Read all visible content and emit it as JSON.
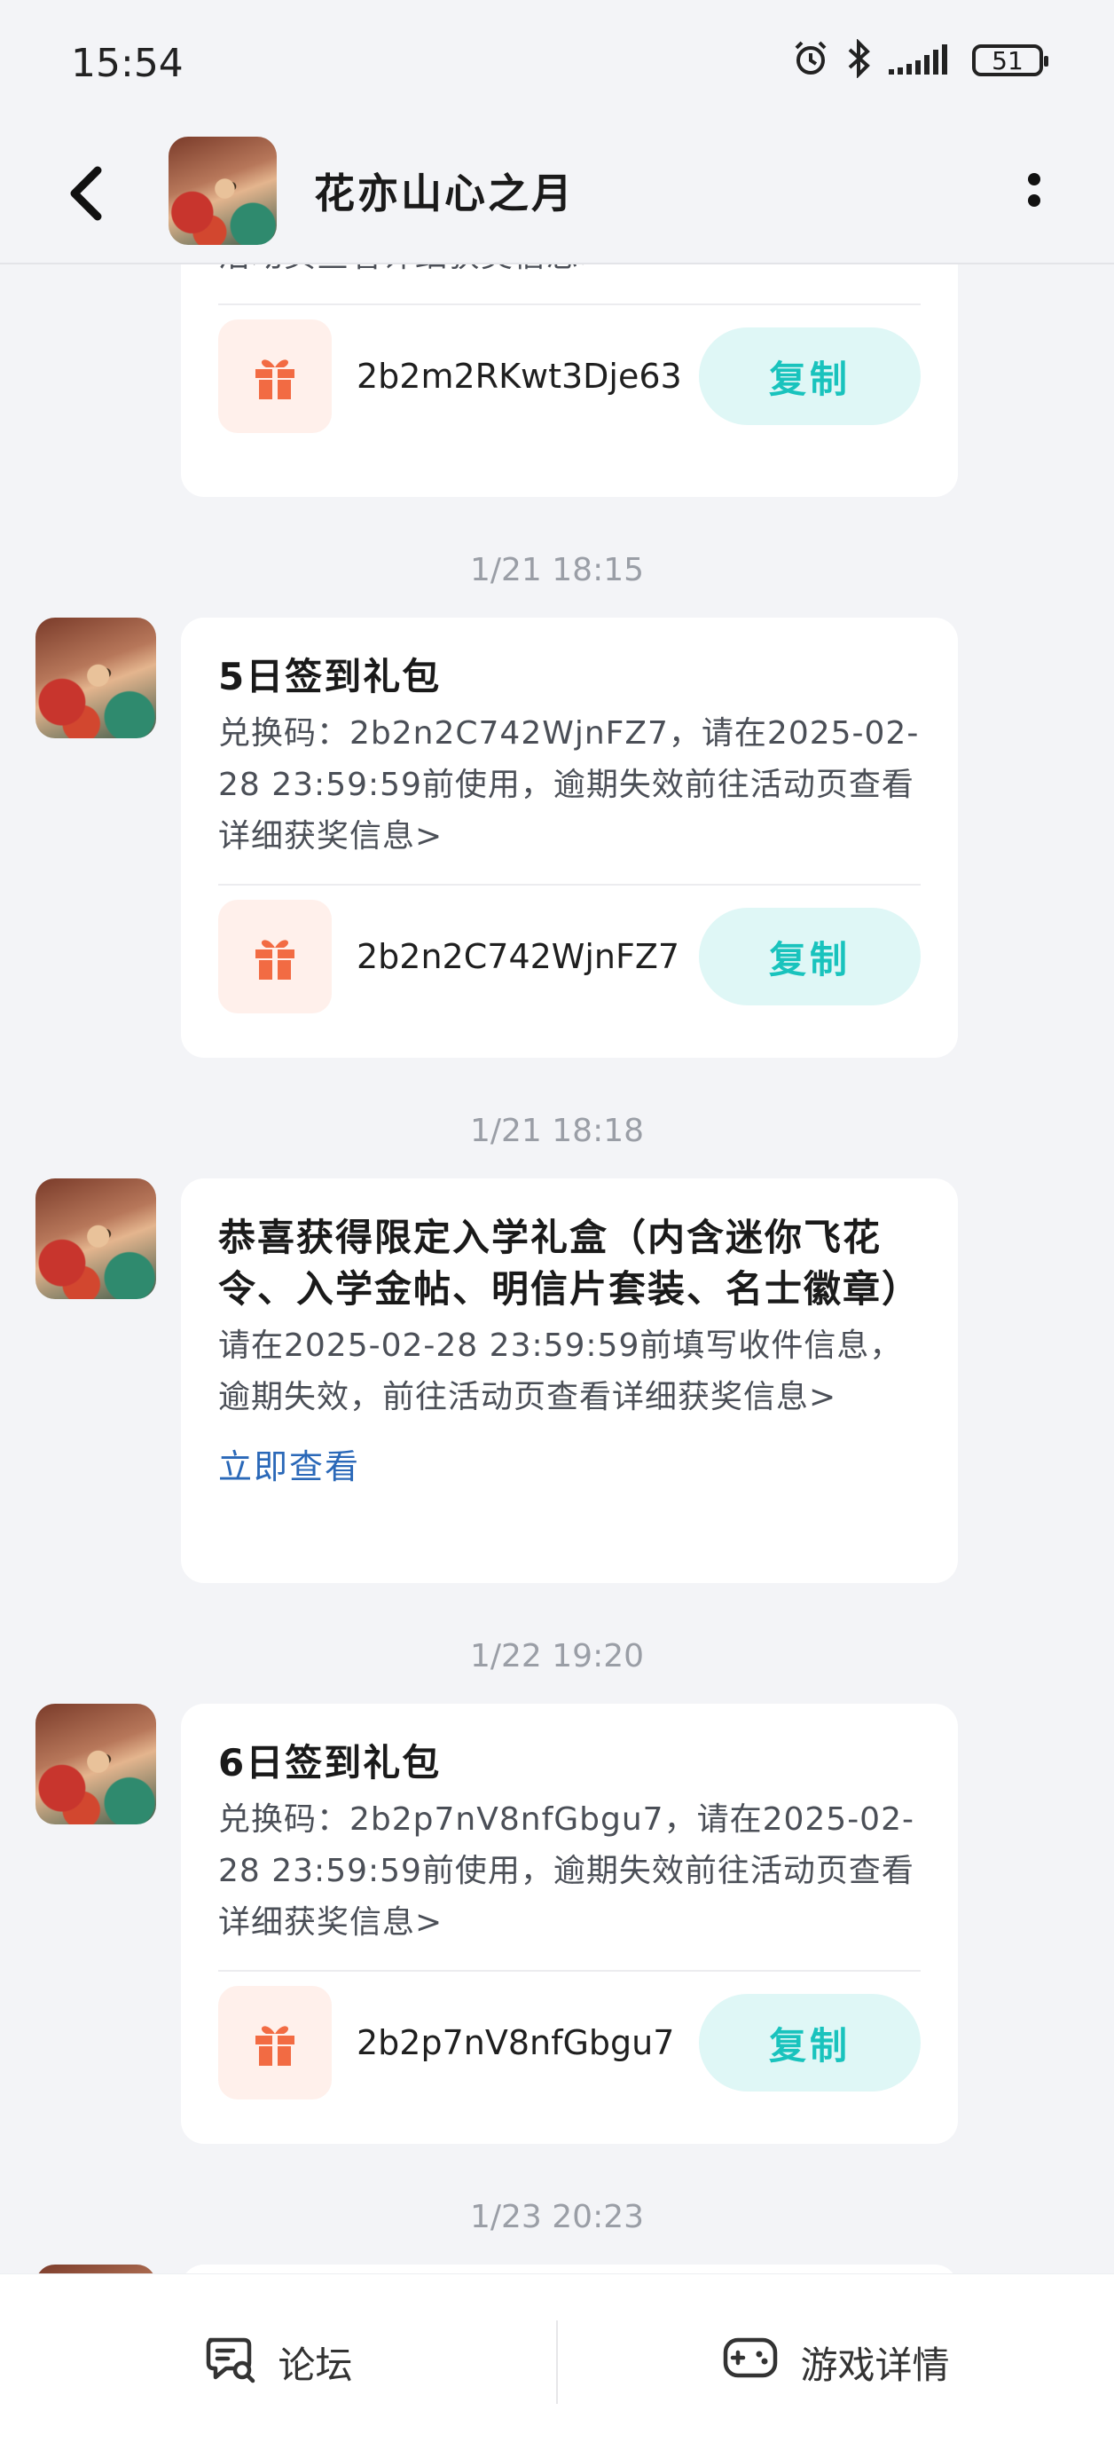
{
  "status_bar": {
    "time": "15:54",
    "battery": "51"
  },
  "header": {
    "title": "花亦山心之月"
  },
  "messages": [
    {
      "body": "活动页查看详细获奖信息>",
      "code": "2b2m2RKwt3Dje63",
      "copy_label": "复制"
    },
    {
      "timestamp": "1/21  18:15",
      "title": "5日签到礼包",
      "body": "兑换码：2b2n2C742WjnFZ7，请在2025-02-28 23:59:59前使用，逾期失效前往活动页查看详细获奖信息>",
      "code": "2b2n2C742WjnFZ7",
      "copy_label": "复制"
    },
    {
      "timestamp": "1/21  18:18",
      "title": "恭喜获得限定入学礼盒（内含迷你飞花令、入学金帖、明信片套装、名士徽章）",
      "body": "请在2025-02-28 23:59:59前填写收件信息，逾期失效，前往活动页查看详细获奖信息>",
      "link": "立即查看"
    },
    {
      "timestamp": "1/22  19:20",
      "title": "6日签到礼包",
      "body": "兑换码：2b2p7nV8nfGbgu7，请在2025-02-28 23:59:59前使用，逾期失效前往活动页查看详细获奖信息>",
      "code": "2b2p7nV8nfGbgu7",
      "copy_label": "复制"
    },
    {
      "timestamp": "1/23  20:23"
    }
  ],
  "bottom_nav": {
    "forum_label": "论坛",
    "game_detail_label": "游戏详情"
  },
  "colors": {
    "accent": "#19c3bd",
    "gift": "#f26b43",
    "link": "#2a68b8"
  }
}
